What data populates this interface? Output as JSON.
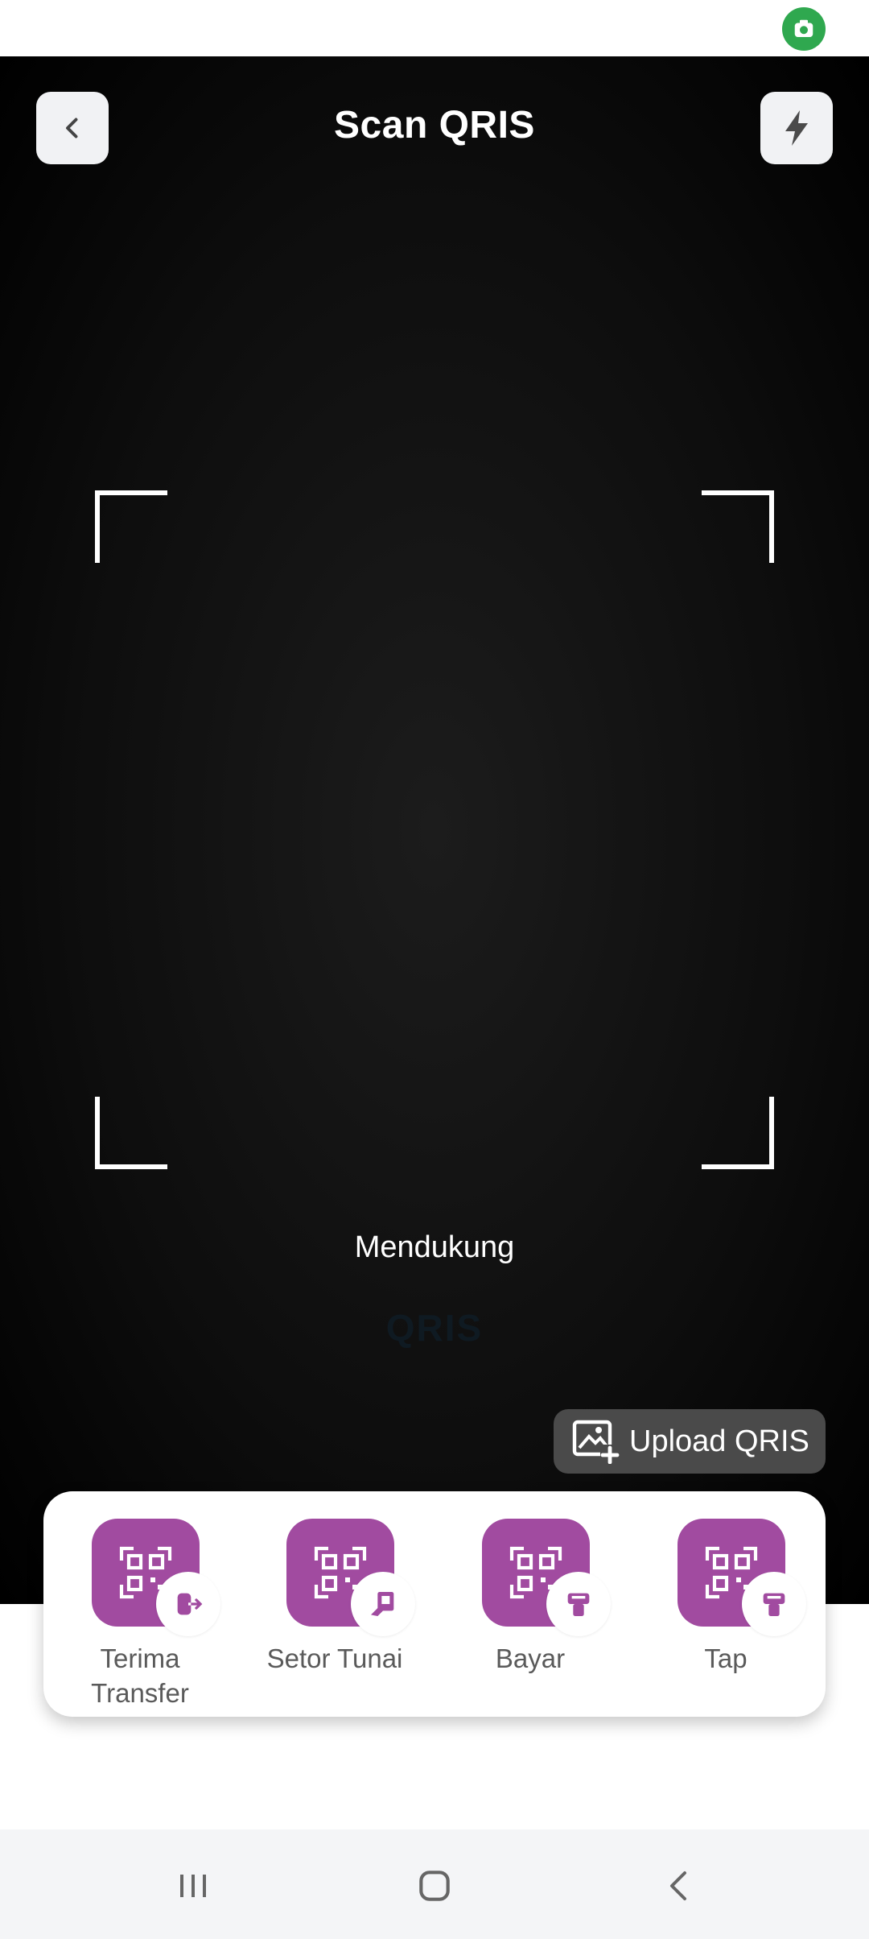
{
  "header": {
    "title": "Scan QRIS"
  },
  "scanner": {
    "supports_label": "Mendukung",
    "logo_text": "QRIS"
  },
  "upload": {
    "label": "Upload QRIS"
  },
  "menu": [
    {
      "label": "Terima Transfer",
      "icon": "qr-receive-icon"
    },
    {
      "label": "Setor Tunai",
      "icon": "qr-cash-deposit-icon"
    },
    {
      "label": "Bayar",
      "icon": "qr-pay-icon"
    },
    {
      "label": "Tap",
      "icon": "qr-tap-icon"
    }
  ],
  "colors": {
    "accent": "#a14ba0",
    "camera_bg": "#0d0d0d",
    "status_indicator": "#2fa84f"
  }
}
